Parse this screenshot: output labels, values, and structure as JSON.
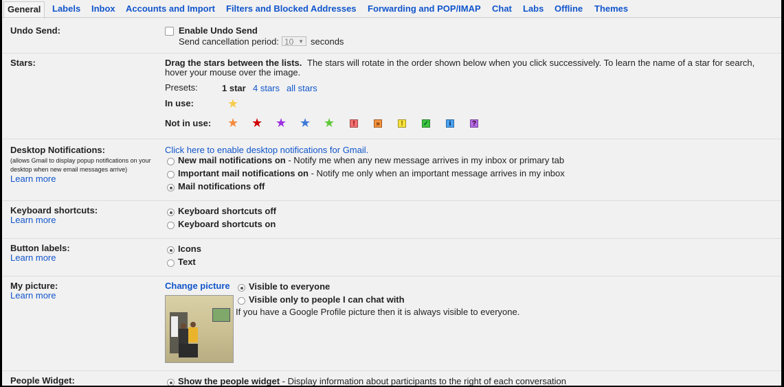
{
  "tabs": [
    {
      "label": "General",
      "active": true
    },
    {
      "label": "Labels"
    },
    {
      "label": "Inbox"
    },
    {
      "label": "Accounts and Import"
    },
    {
      "label": "Filters and Blocked Addresses"
    },
    {
      "label": "Forwarding and POP/IMAP"
    },
    {
      "label": "Chat"
    },
    {
      "label": "Labs"
    },
    {
      "label": "Offline"
    },
    {
      "label": "Themes"
    }
  ],
  "undo_send": {
    "title": "Undo Send:",
    "checkbox_label": "Enable Undo Send",
    "period_label": "Send cancellation period:",
    "period_value": "10",
    "seconds": "seconds"
  },
  "stars": {
    "title": "Stars:",
    "instructions_bold": "Drag the stars between the lists.",
    "instructions_line1": "The stars will rotate in the order shown below when you click successively. To learn the name of a star for search,",
    "instructions_line2": "hover your mouse over the image.",
    "presets_label": "Presets:",
    "preset_1": "1 star",
    "preset_4": "4 stars",
    "preset_all": "all stars",
    "in_use_label": "In use:",
    "not_in_use_label": "Not in use:",
    "colors": {
      "yellow": "#f7cb4d",
      "orange": "#f28a3c",
      "red": "#d00000",
      "purple": "#9b30e0",
      "blue": "#3d79d6",
      "green": "#5fc83a"
    },
    "markers": {
      "red_bang": "!",
      "orange_guillemet": "»",
      "yellow_bang": "!",
      "green_check": "✓",
      "blue_info": "i",
      "purple_question": "?"
    }
  },
  "desktop": {
    "title": "Desktop Notifications:",
    "note_line1": "(allows Gmail to display popup notifications on your",
    "note_line2": "desktop when new email messages arrive)",
    "learn_more": "Learn more",
    "enable_link": "Click here to enable desktop notifications for Gmail.",
    "opt1_bold": "New mail notifications on",
    "opt1_rest": " - Notify me when any new message arrives in my inbox or primary tab",
    "opt2_bold": "Important mail notifications on",
    "opt2_rest": " - Notify me only when an important message arrives in my inbox",
    "opt3_bold": "Mail notifications off"
  },
  "keyboard": {
    "title": "Keyboard shortcuts:",
    "learn_more": "Learn more",
    "opt_off": "Keyboard shortcuts off",
    "opt_on": "Keyboard shortcuts on"
  },
  "buttons": {
    "title": "Button labels:",
    "learn_more": "Learn more",
    "opt_icons": "Icons",
    "opt_text": "Text"
  },
  "picture": {
    "title": "My picture:",
    "learn_more": "Learn more",
    "change": "Change picture",
    "opt_everyone": "Visible to everyone",
    "opt_chat": "Visible only to people I can chat with",
    "note": "If you have a Google Profile picture then it is always visible to everyone."
  },
  "people": {
    "title": "People Widget:",
    "opt_bold": "Show the people widget",
    "opt_rest": " - Display information about participants to the right of each conversation"
  }
}
